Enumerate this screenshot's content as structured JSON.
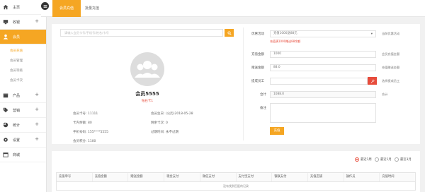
{
  "sidebar": {
    "items": [
      {
        "key": "home",
        "label": "主页",
        "has_plus": false
      },
      {
        "key": "cashier",
        "label": "收银",
        "has_plus": true
      },
      {
        "key": "member",
        "label": "会员",
        "has_plus": false,
        "active": true
      },
      {
        "key": "product",
        "label": "产品",
        "has_plus": true
      },
      {
        "key": "marketing",
        "label": "营销",
        "has_plus": true
      },
      {
        "key": "stats",
        "label": "统计",
        "has_plus": true
      },
      {
        "key": "settings",
        "label": "设置",
        "has_plus": true
      },
      {
        "key": "mall",
        "label": "商城",
        "has_plus": false
      }
    ],
    "member_sub": [
      {
        "label": "会员充值",
        "active": true
      },
      {
        "label": "会员管理"
      },
      {
        "label": "会员等级"
      },
      {
        "label": "会员卡次"
      }
    ]
  },
  "tabs": {
    "active": "会员充值",
    "other": "批量充值"
  },
  "search": {
    "placeholder": "请输入会员卡号/手机号/姓名/卡号"
  },
  "member": {
    "name": "会员5555",
    "level": "钻石卡1",
    "card_no_label": "会员卡号:",
    "card_no": "11111",
    "birthday_label": "会员生日:",
    "birthday": "(公历)2018-05-28",
    "balance_label": "卡内余额:",
    "balance": "80",
    "count_label": "剩余卡次:",
    "count": "0",
    "phone_label": "手机号码:",
    "phone": "155****5555",
    "expire_label": "过期时间:",
    "expire": "永不过期",
    "points_label": "会员积分:",
    "points": "1100"
  },
  "form": {
    "promo_label": "优惠活动",
    "promo_value": "充值1000送88元",
    "promo_hint": "当前优惠活动",
    "promo_note": "充值满1000赠送88余额",
    "amount_label": "充值金额",
    "amount_value": "1000",
    "amount_hint": "会员充值金额",
    "gift_label": "赠送金额",
    "gift_value": "88.0",
    "gift_hint": "充值赠送金额",
    "staff_label": "提成员工",
    "staff_hint": "选择提成员工",
    "total_label": "合计",
    "total_value": "1088.0",
    "total_hint": "合计",
    "remark_label": "备注",
    "submit": "充值"
  },
  "filters": {
    "options": [
      "最近1周",
      "最近1月",
      "最近3月"
    ],
    "selected": 0
  },
  "table": {
    "headers": [
      "充值单号",
      "充值金额",
      "赠送金额",
      "现金支付",
      "微信支付",
      "支付宝支付",
      "银联支付",
      "充值店铺",
      "操作员",
      "充值时间"
    ],
    "empty_text": "没有找到匹配的记录"
  },
  "colors": {
    "accent": "#f5a623",
    "danger": "#e74c3c"
  }
}
